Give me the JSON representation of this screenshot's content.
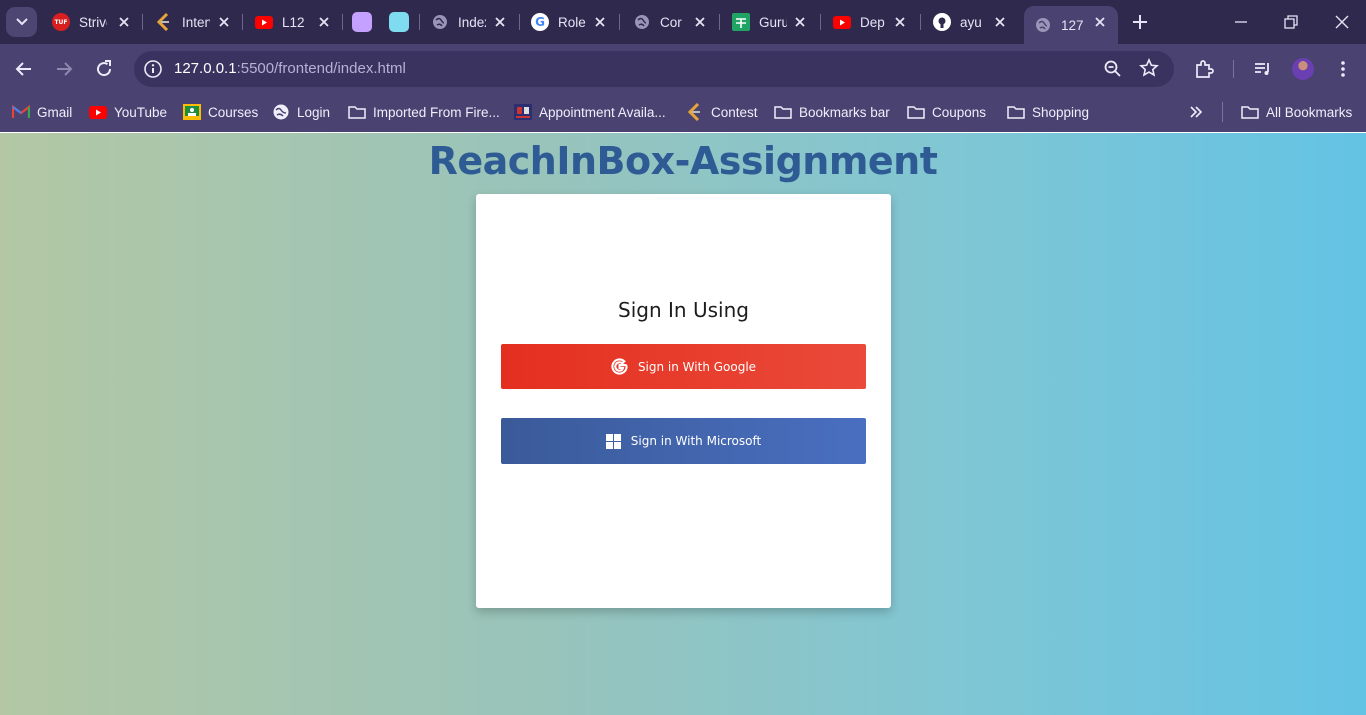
{
  "browser": {
    "tabs": [
      {
        "title": "Striver",
        "favicon": "tuf-icon",
        "favicon_text": "TUF",
        "favicon_color": "#d81e1e"
      },
      {
        "title": "Interview",
        "favicon": "coding-logo-icon",
        "favicon_color": "#e8a33a"
      },
      {
        "title": "L12",
        "favicon": "youtube-icon",
        "favicon_color": "#ff0000"
      },
      {
        "title": "",
        "favicon": "purple-square-icon",
        "favicon_color": "#c4a0ff"
      },
      {
        "title": "",
        "favicon": "cyan-square-icon",
        "favicon_color": "#7fdcf0"
      },
      {
        "title": "Index",
        "favicon": "globe-icon",
        "favicon_color": "#9a94b8"
      },
      {
        "title": "Roles",
        "favicon": "google-icon",
        "favicon_color": "#ffffff"
      },
      {
        "title": "Cor",
        "favicon": "globe-icon",
        "favicon_color": "#9a94b8"
      },
      {
        "title": "Guru",
        "favicon": "sheets-icon",
        "favicon_color": "#1fa463"
      },
      {
        "title": "Dep",
        "favicon": "youtube-icon",
        "favicon_color": "#ff0000"
      },
      {
        "title": "ayu",
        "favicon": "github-icon",
        "favicon_color": "#ffffff"
      },
      {
        "title": "127.",
        "favicon": "globe-icon",
        "favicon_color": "#9a94b8",
        "active": true
      }
    ],
    "url_host": "127.0.0.1",
    "url_rest": ":5500/frontend/index.html",
    "bookmarks": [
      {
        "label": "Gmail",
        "icon": "gmail-icon"
      },
      {
        "label": "YouTube",
        "icon": "youtube-icon"
      },
      {
        "label": "Courses",
        "icon": "classroom-icon"
      },
      {
        "label": "Login",
        "icon": "globe-icon"
      },
      {
        "label": "Imported From Fire...",
        "icon": "folder-icon"
      },
      {
        "label": "Appointment Availa...",
        "icon": "site-icon"
      },
      {
        "label": "Contest",
        "icon": "coding-logo-icon"
      },
      {
        "label": "Bookmarks bar",
        "icon": "folder-icon"
      },
      {
        "label": "Coupons",
        "icon": "folder-icon"
      },
      {
        "label": "Shopping",
        "icon": "folder-icon"
      }
    ],
    "all_bookmarks_label": "All Bookmarks"
  },
  "page": {
    "heading": "ReachInBox-Assignment",
    "card_title": "Sign In Using",
    "google_button_label": "Sign in With Google",
    "microsoft_button_label": "Sign in With Microsoft"
  },
  "colors": {
    "heading": "#2e5b94",
    "google_button": "#e42f1f",
    "microsoft_button": "#3a5a99",
    "tab_strip": "#2f2a4d",
    "toolbar": "#4a4271"
  }
}
